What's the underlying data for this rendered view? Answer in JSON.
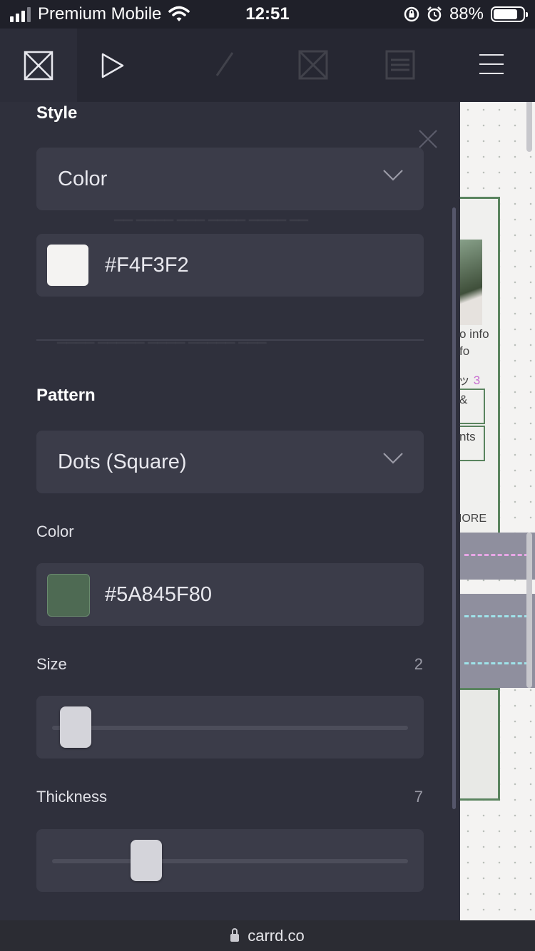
{
  "status_bar": {
    "carrier": "Premium Mobile",
    "time": "12:51",
    "battery": "88%",
    "battery_level": 0.88
  },
  "toolbar": {
    "logo_icon": "carrd-logo-icon",
    "play_icon": "play-icon",
    "menu_icon": "hamburger-menu-icon"
  },
  "panel": {
    "style_title": "Style",
    "style_select": "Color",
    "background_color": {
      "value": "#F4F3F2",
      "swatch": "#f4f3f2"
    },
    "pattern_title": "Pattern",
    "pattern_select": "Dots (Square)",
    "pattern_color_label": "Color",
    "pattern_color": {
      "value": "#5A845F80",
      "swatch": "#4e6a53"
    },
    "size": {
      "label": "Size",
      "value": "2",
      "level": 0.02
    },
    "thickness": {
      "label": "Thickness",
      "value": "7",
      "level": 0.24
    }
  },
  "canvas": {
    "info_1": "o info",
    "info_2": "fo",
    "jp_text": "ッ",
    "jp_mark": "3",
    "amp_text": "&",
    "nts_text": "nts",
    "more_text": "MORE",
    "pink_dash": "#e7a6e6",
    "cyan_dash": "#9fe3ea",
    "border_color": "#5a845f"
  },
  "url_bar": {
    "domain": "carrd.co"
  }
}
